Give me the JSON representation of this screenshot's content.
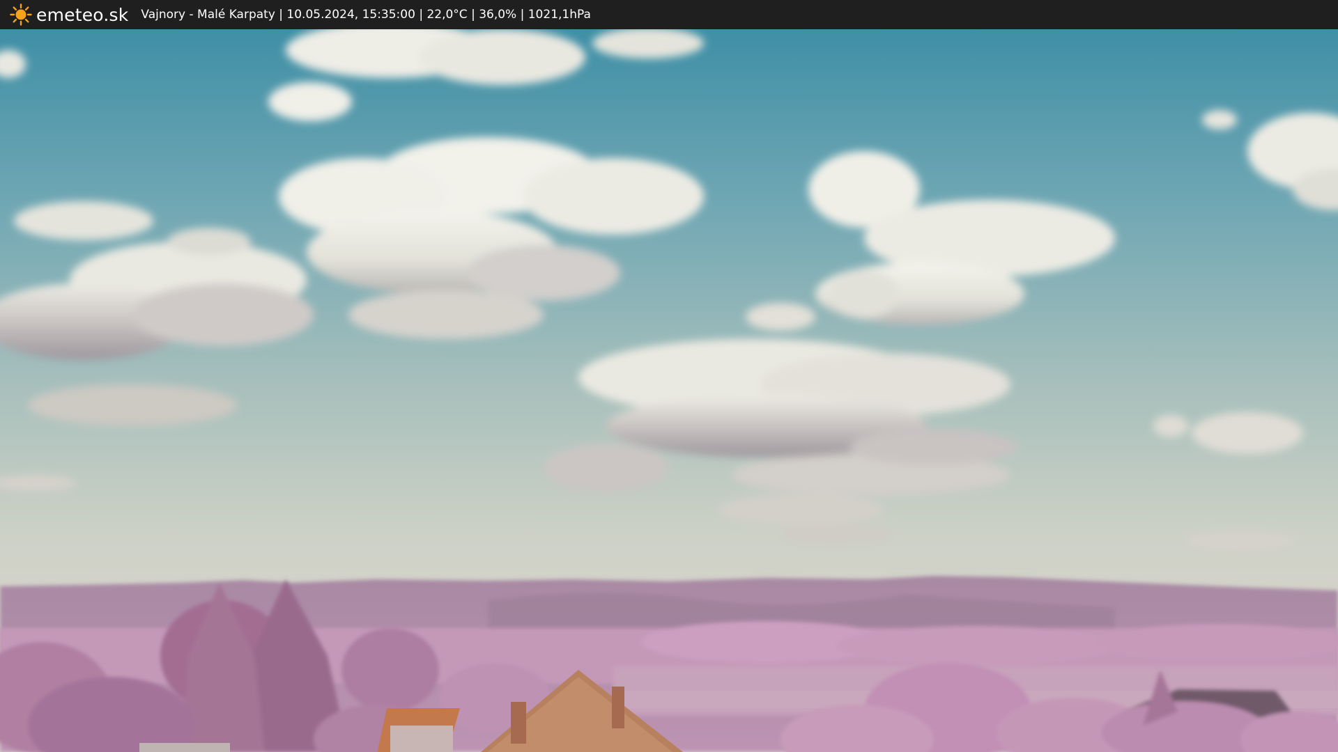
{
  "header": {
    "brand": "emeteo.sk",
    "logo_icon": "sun-icon",
    "caption": "Vajnory - Malé Karpaty | 10.05.2024, 15:35:00 | 22,0°C | 36,0% | 1021,1hPa"
  },
  "colors": {
    "bar_background": "#1f1f1f",
    "sun": "#f6a21a",
    "sky_top": "#3f8fa6",
    "sky_horizon": "#cfd2c8",
    "foliage": "#b98aa8",
    "roof": "#c47c4e"
  }
}
